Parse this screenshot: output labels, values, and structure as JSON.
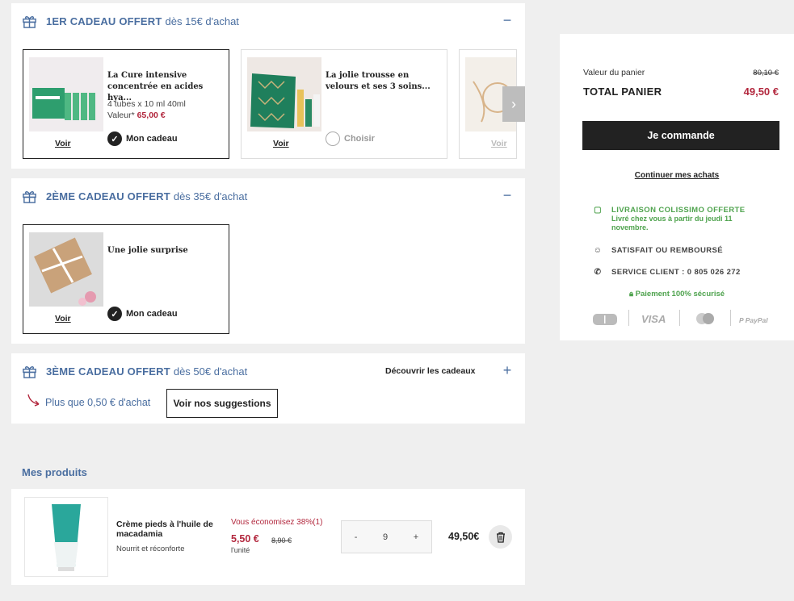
{
  "gift1": {
    "title": "1ER CADEAU OFFERT",
    "sub": "dès 15€ d'achat",
    "toggle": "−",
    "cards": [
      {
        "name": "La Cure intensive concentrée en acides hya...",
        "desc": "4 tubes x 10 ml 40ml",
        "value_label": "Valeur*",
        "value": "65,00 €",
        "voir": "Voir",
        "choice": "Mon cadeau"
      },
      {
        "name": "La jolie trousse en velours et ses 3 soins...",
        "voir": "Voir",
        "choice": "Choisir"
      },
      {
        "voir": "Voir"
      }
    ]
  },
  "gift2": {
    "title": "2ÈME CADEAU OFFERT",
    "sub": "dès 35€ d'achat",
    "toggle": "−",
    "card": {
      "name": "Une jolie surprise",
      "voir": "Voir",
      "choice": "Mon cadeau"
    }
  },
  "gift3": {
    "title": "3ÈME CADEAU OFFERT",
    "sub": "dès 50€ d'achat",
    "discover": "Découvrir les cadeaux",
    "toggle": "+",
    "remaining": "Plus que 0,50 € d'achat",
    "suggest": "Voir nos suggestions"
  },
  "products": {
    "title": "Mes produits",
    "item": {
      "name": "Crème pieds à l'huile de macadamia",
      "desc": "Nourrit et réconforte",
      "saving": "Vous économisez 38%(1)",
      "price": "5,50 €",
      "old_price": "8,90 €",
      "unit": "l'unité",
      "qty_minus": "-",
      "qty": "9",
      "qty_plus": "+",
      "total": "49,50€"
    }
  },
  "summary": {
    "cart_value_label": "Valeur du panier",
    "cart_value": "80,10 €",
    "total_label": "TOTAL PANIER",
    "total": "49,50 €",
    "order_button": "Je commande",
    "continue": "Continuer mes achats",
    "delivery_title": "LIVRAISON COLISSIMO OFFERTE",
    "delivery_sub": "Livré chez vous à partir du jeudi 11 novembre.",
    "refund": "SATISFAIT OU REMBOURSÉ",
    "service": "SERVICE CLIENT : 0 805 026 272",
    "secure": "Paiement 100% sécurisé",
    "pay_visa": "VISA",
    "pay_paypal": "PayPal",
    "accent_green": "#4fa34e",
    "accent_red": "#b2273d",
    "accent_blue": "#4a6ea0"
  }
}
